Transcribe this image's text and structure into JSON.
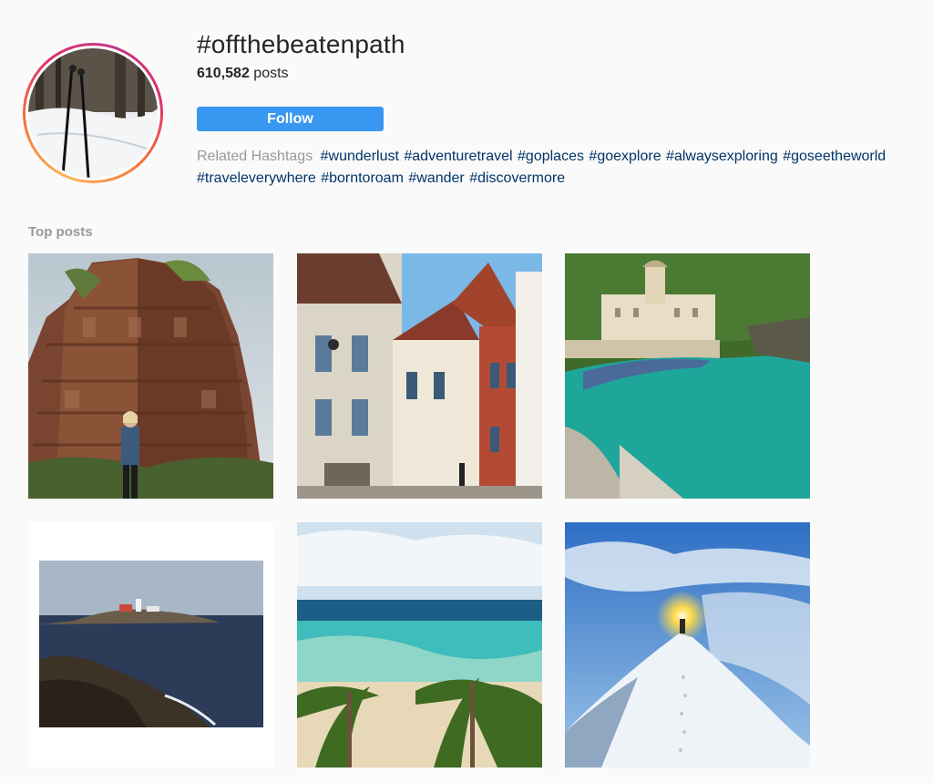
{
  "header": {
    "hashtag": "#offthebeatenpath",
    "post_count": "610,582",
    "post_count_suffix": " posts",
    "follow_label": "Follow"
  },
  "related": {
    "label": "Related Hashtags",
    "tags": [
      "#wunderlust",
      "#adventuretravel",
      "#goplaces",
      "#goexplore",
      "#alwaysexploring",
      "#goseetheworld",
      "#traveleverywhere",
      "#borntoroam",
      "#wander",
      "#discovermore"
    ]
  },
  "top_posts": {
    "title": "Top posts",
    "posts": [
      {
        "subject": "ancient-brick-temple-with-traveler"
      },
      {
        "subject": "european-street-houses"
      },
      {
        "subject": "coastal-village-bay"
      },
      {
        "subject": "lighthouse-rocky-coast"
      },
      {
        "subject": "tropical-beach-palms"
      },
      {
        "subject": "snowy-mountain-summit-sunburst"
      }
    ]
  }
}
